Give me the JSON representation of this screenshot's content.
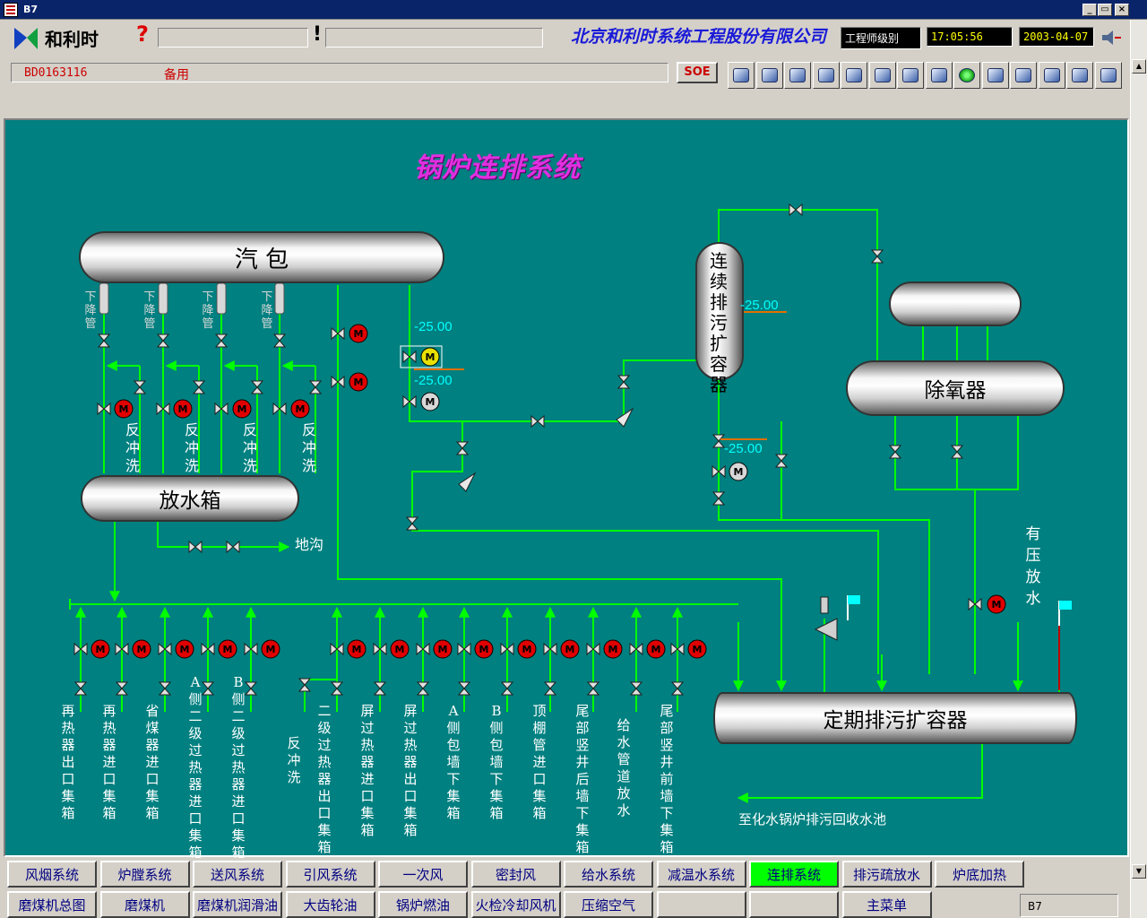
{
  "window": {
    "title": "B7",
    "minimize": "_",
    "restore": "▭",
    "close": "×"
  },
  "header": {
    "company": "北京和利时系统工程股份有限公司",
    "role": "工程师级别",
    "time": "17:05:56",
    "date": "2003-04-07",
    "question": "?",
    "exclaim": "!",
    "tag_id": "BD0163116",
    "tag_desc": "备用",
    "soe_label": "SOE"
  },
  "toolbar": {
    "icons": [
      "view-icon",
      "home-icon",
      "pump-icon",
      "back-icon",
      "left-icon",
      "right-icon",
      "copy-icon",
      "alarm-icon",
      "green-status-icon",
      "print-icon",
      "print-cancel-icon",
      "print-setup-icon",
      "trend-icon",
      "report-icon"
    ]
  },
  "diagram": {
    "title": "锅炉连排系统",
    "drum": "汽  包",
    "drain_tank": "放水箱",
    "cont_blowdown": "连续排污扩容器",
    "deaerator": "除氧器",
    "periodic_blowdown": "定期排污扩容器",
    "downcomer": "下降管",
    "backflush": "反冲洗",
    "trench": "地沟",
    "pressure_drain": "有压放水",
    "to_recovery": "至化水锅炉排污回收水池",
    "values": {
      "v1": "-25.00",
      "v2": "-25.00",
      "v3": "-25.00",
      "v4": "-25.00"
    },
    "headers": [
      "再热器出口集箱",
      "再热器进口集箱",
      "省煤器进口集箱",
      "A侧二级过热器进口集箱",
      "B侧二级过热器进口集箱",
      "反冲洗",
      "二级过热器出口集箱",
      "屏过热器进口集箱",
      "屏过热器出口集箱",
      "A侧包墙下集箱",
      "B侧包墙下集箱",
      "顶棚管进口集箱",
      "尾部竖井后墙下集箱",
      "给水管道放水",
      "尾部竖井前墙下集箱"
    ]
  },
  "nav": {
    "row1": [
      "风烟系统",
      "炉膛系统",
      "送风系统",
      "引风系统",
      "一次风",
      "密封风",
      "给水系统",
      "减温水系统",
      "连排系统",
      "排污疏放水",
      "炉底加热"
    ],
    "row2": [
      "磨煤机总图",
      "磨煤机",
      "磨煤机润滑油",
      "大齿轮油",
      "锅炉燃油",
      "火检冷却风机",
      "压缩空气",
      "",
      "",
      "主菜单"
    ],
    "page_label": "B7",
    "active": "连排系统"
  }
}
